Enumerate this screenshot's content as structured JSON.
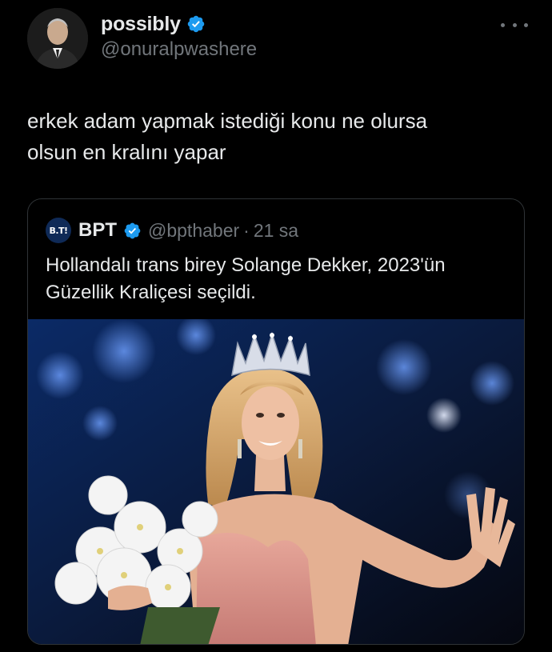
{
  "author": {
    "display_name": "possibly",
    "handle": "@onuralpwashere",
    "verified": true,
    "avatar_icon": "profile-photo-man-in-suit"
  },
  "menu_icon": "more-horizontal-icon",
  "tweet": {
    "text_line1": "erkek adam yapmak istediği konu ne olursa",
    "text_line2": "olsun en kralını yapar"
  },
  "quoted": {
    "avatar_text": "B.T!",
    "display_name": "BPT",
    "verified": true,
    "handle": "@bpthaber",
    "separator": "·",
    "time": "21 sa",
    "text_line1": "Hollandalı trans birey Solange Dekker, 2023'ün",
    "text_line2": "Güzellik Kraliçesi seçildi.",
    "media_icon": "photo-beauty-queen-with-crown-and-bouquet"
  },
  "colors": {
    "background": "#000000",
    "text_primary": "#e7e9ea",
    "text_secondary": "#71767b",
    "verified_blue": "#1d9bf0",
    "border": "#2f3336"
  }
}
